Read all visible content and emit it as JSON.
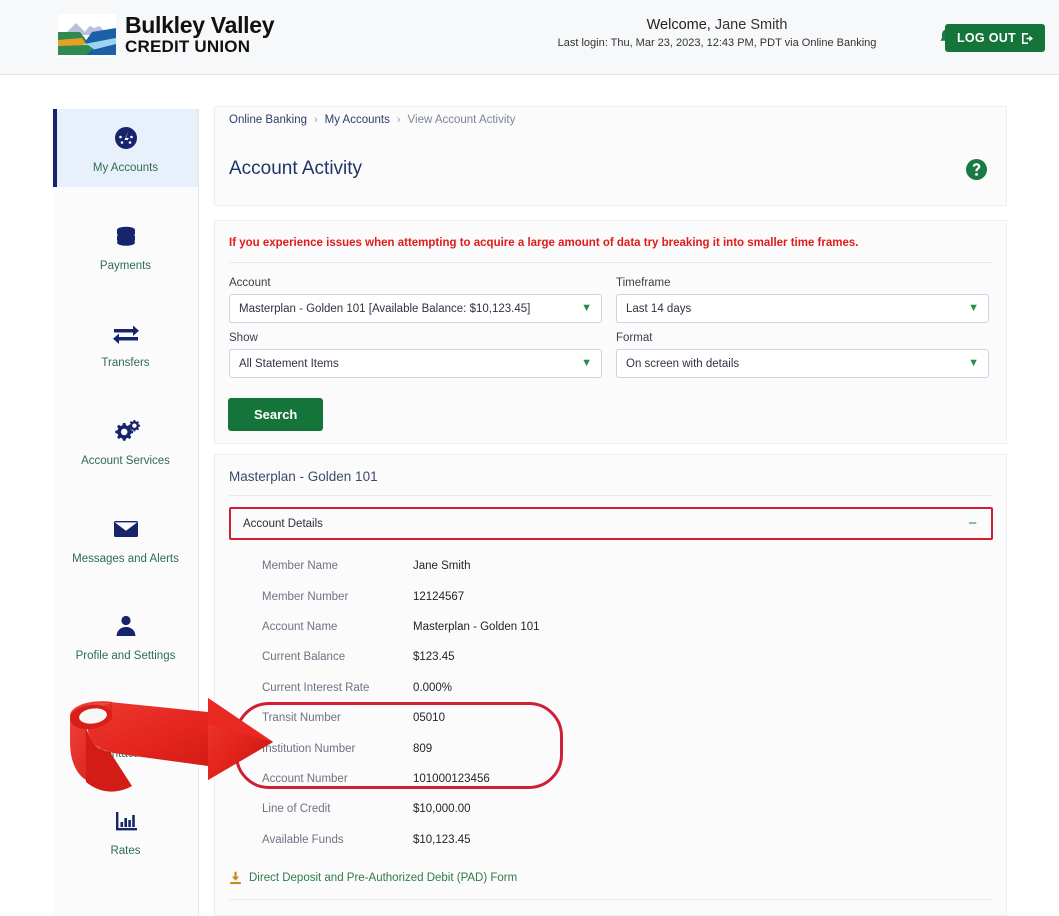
{
  "header": {
    "brand_line1": "Bulkley Valley",
    "brand_line2": "CREDIT UNION",
    "logo_icon": "mountain-valley-logo",
    "welcome_prefix": "Welcome,",
    "user_name": "Jane Smith",
    "last_login": "Last login: Thu, Mar 23, 2023, 12:43 PM, PDT via Online Banking",
    "bell_icon": "notification-bell-icon",
    "logout_label": "LOG OUT",
    "logout_icon": "sign-out-icon",
    "brand_green": "#15743a",
    "brand_navy": "#16256b"
  },
  "sidebar": {
    "items": [
      {
        "label": "My Accounts",
        "icon": "gauge-icon",
        "active": true
      },
      {
        "label": "Payments",
        "icon": "coins-stack-icon",
        "active": false
      },
      {
        "label": "Transfers",
        "icon": "exchange-arrows-icon",
        "active": false
      },
      {
        "label": "Account Services",
        "icon": "gears-icon",
        "active": false
      },
      {
        "label": "Messages and Alerts",
        "icon": "envelope-icon",
        "active": false
      },
      {
        "label": "Profile and Settings",
        "icon": "user-icon",
        "active": false
      },
      {
        "label": "Contact Us",
        "icon": "gauge-icon",
        "active": false
      },
      {
        "label": "Rates",
        "icon": "bar-chart-icon",
        "active": false
      }
    ]
  },
  "breadcrumb": {
    "items": [
      "Online Banking",
      "My Accounts",
      "View Account Activity"
    ],
    "separator": "›"
  },
  "page": {
    "title": "Account Activity",
    "help_icon": "help-circle-icon"
  },
  "search_panel": {
    "warning": "If you experience issues when attempting to acquire a large amount of data try breaking it into smaller time frames.",
    "fields": [
      {
        "label": "Account",
        "value": "Masterplan - Golden 101 [Available Balance: $10,123.45]"
      },
      {
        "label": "Timeframe",
        "value": "Last 14 days"
      },
      {
        "label": "Show",
        "value": "All Statement Items"
      },
      {
        "label": "Format",
        "value": "On screen with details"
      }
    ],
    "search_button": "Search",
    "chevron_icon": "chevron-down-icon"
  },
  "results": {
    "account_heading": "Masterplan - Golden 101",
    "accordion_label": "Account Details",
    "accordion_toggle": "−",
    "rows": [
      {
        "label": "Member Name",
        "value": "Jane Smith"
      },
      {
        "label": "Member Number",
        "value": "12124567"
      },
      {
        "label": "Account Name",
        "value": "Masterplan - Golden 101"
      },
      {
        "label": "Current Balance",
        "value": "$123.45"
      },
      {
        "label": "Current Interest Rate",
        "value": "0.000%"
      },
      {
        "label": "Transit Number",
        "value": "05010"
      },
      {
        "label": "Institution Number",
        "value": "809"
      },
      {
        "label": "Account Number",
        "value": "101000123456"
      },
      {
        "label": "Line of Credit",
        "value": "$10,000.00"
      },
      {
        "label": "Available Funds",
        "value": "$10,123.45"
      }
    ],
    "pad_form_link": "Direct Deposit and Pre-Authorized Debit (PAD) Form",
    "pad_icon": "download-icon"
  },
  "annotations": {
    "highlight_color": "#cf1f36",
    "arrow_icon": "curved-right-arrow-icon",
    "highlighted_rows": [
      "Transit Number",
      "Institution Number",
      "Account Number"
    ],
    "highlighted_section": "Account Details"
  }
}
